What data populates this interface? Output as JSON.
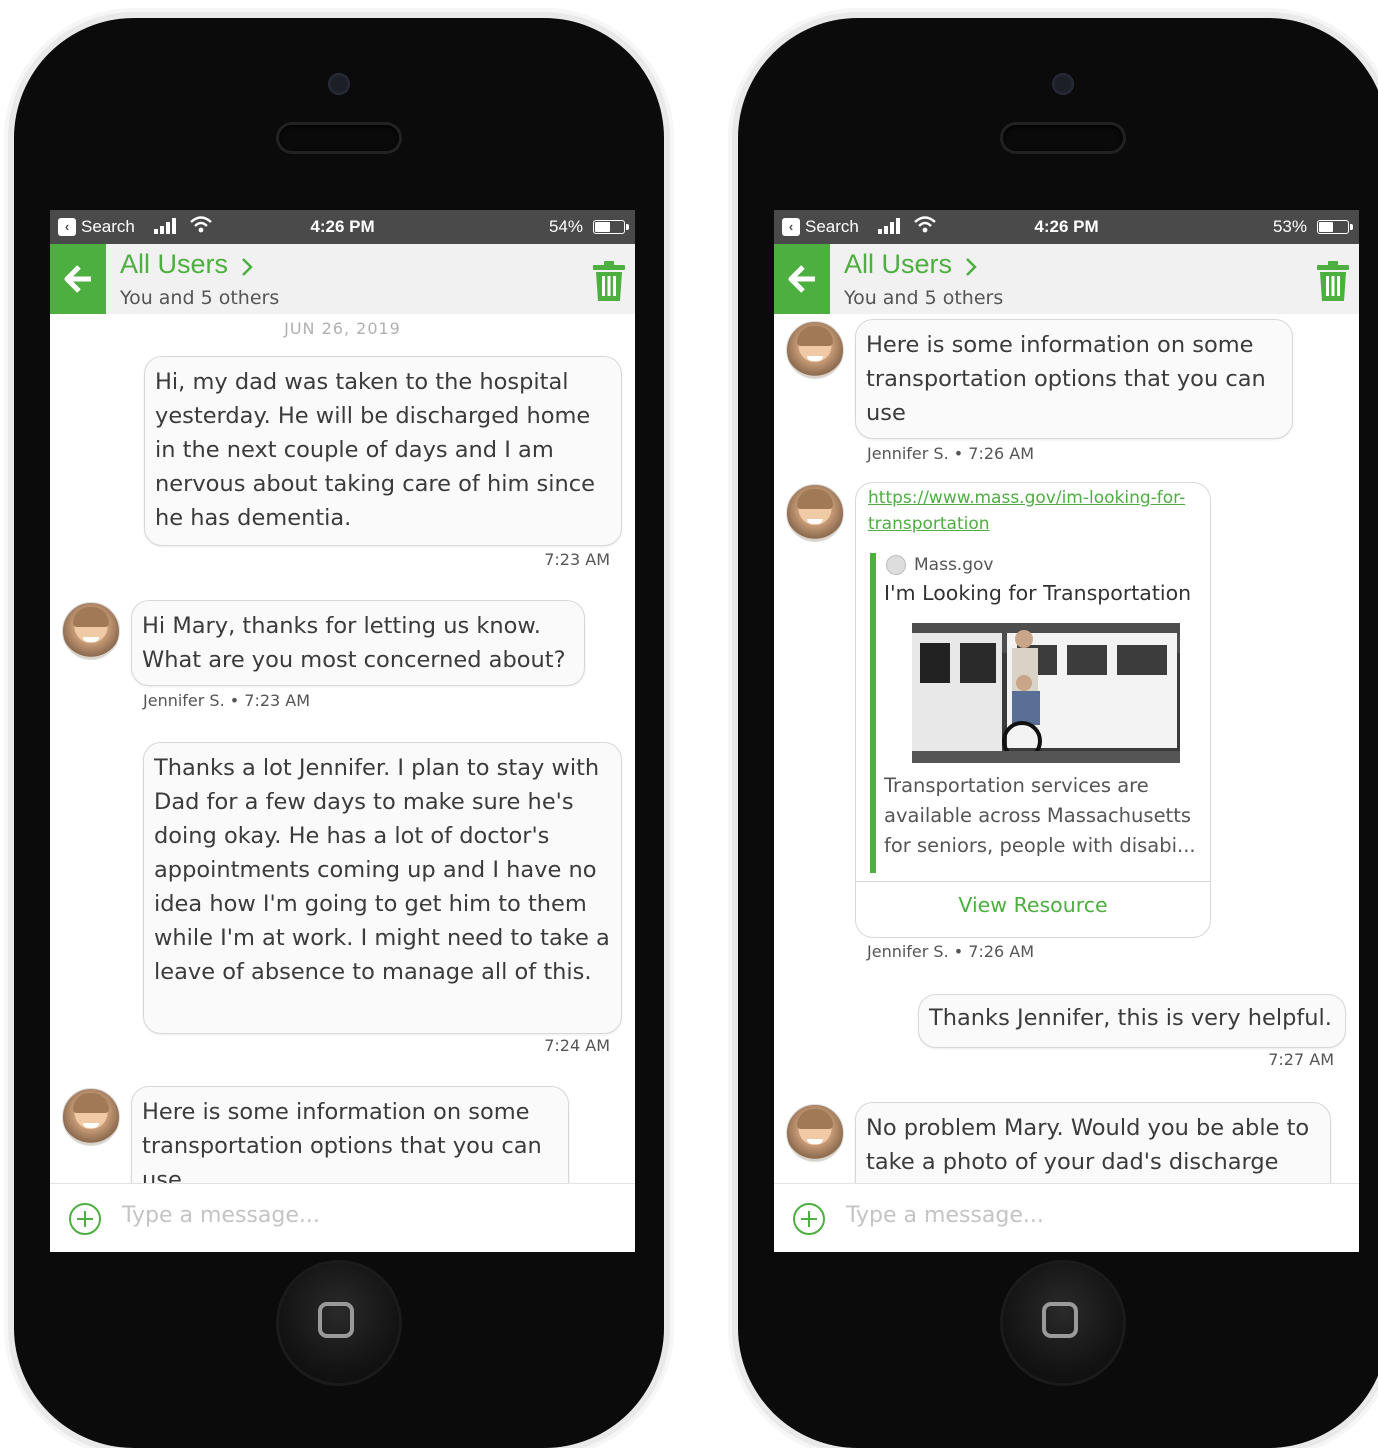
{
  "left_screen": {
    "status": {
      "back_label": "Search",
      "time": "4:26 PM",
      "battery": "54%",
      "battery_fill": 0.54
    },
    "header": {
      "title": "All Users",
      "chevron": ">",
      "subtitle": "You and 5 others"
    },
    "date_separator": "JUN 26, 2019",
    "messages": [
      {
        "text": "Hi, my dad was taken to the hospital yesterday.  He will be discharged home in the next couple of days and I am nervous about taking care of him since he has dementia.",
        "meta": "7:23 AM"
      },
      {
        "text": "Hi Mary, thanks for letting us know. What are you most concerned about?",
        "meta": "Jennifer S. • 7:23 AM"
      },
      {
        "text": "Thanks a lot Jennifer. I plan to stay with Dad for a few days to make sure he's doing okay. He has a lot of doctor's appointments coming up and I have no idea how I'm going to get him to them while I'm at work. I might need to take a leave of absence to manage all of this.",
        "meta": "7:24 AM"
      },
      {
        "text": "Here is some information on some transportation options that you can use"
      }
    ],
    "composer": {
      "placeholder": "Type a message..."
    }
  },
  "right_screen": {
    "status": {
      "back_label": "Search",
      "time": "4:26 PM",
      "battery": "53%",
      "battery_fill": 0.53
    },
    "header": {
      "title": "All Users",
      "chevron": ">",
      "subtitle": "You and 5 others"
    },
    "messages": [
      {
        "text": "Here is some information on some transportation options that you can use",
        "meta": "Jennifer S. • 7:26 AM"
      },
      {
        "link_url": "https://www.mass.gov/im-looking-for-transportation",
        "site": "Mass.gov",
        "title": "I'm Looking for Transportation",
        "description": "Transportation services are available across Massachusetts for seniors, people with disabi...",
        "button": "View Resource",
        "meta": "Jennifer S. • 7:26 AM"
      },
      {
        "text": "Thanks Jennifer, this is very helpful.",
        "meta": "7:27 AM"
      },
      {
        "text": "No problem Mary.  Would you be able to take a photo of your dad's discharge"
      }
    ],
    "composer": {
      "placeholder": "Type a message..."
    }
  },
  "colors": {
    "accent": "#4caf3f",
    "status_bar": "#4a4a4a",
    "header_bg": "#f1f1f1",
    "bubble_border": "#d8d8d8"
  },
  "icons": {
    "back": "arrow-left-icon",
    "trash": "trash-icon",
    "add": "plus-circle-icon",
    "signal": "signal-icon",
    "wifi": "wifi-icon",
    "battery": "battery-icon"
  }
}
